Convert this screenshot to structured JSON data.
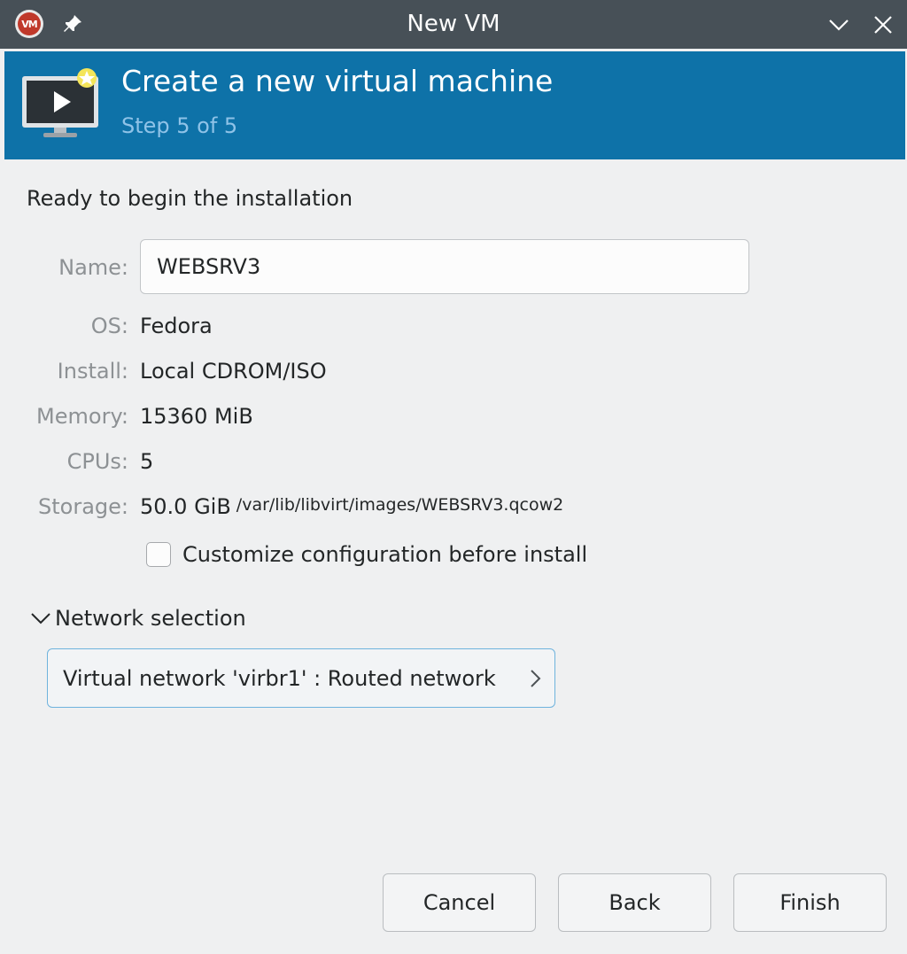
{
  "window": {
    "title": "New VM",
    "app_icon": "virt-manager-icon",
    "app_icon_text": "VM"
  },
  "header": {
    "title": "Create a new virtual machine",
    "step": "Step 5 of 5",
    "background": "#0e72a8",
    "icon": "monitor-play-icon"
  },
  "summary": {
    "heading": "Ready to begin the installation",
    "name_label": "Name:",
    "name_value": "WEBSRV3",
    "os_label": "OS:",
    "os_value": "Fedora",
    "install_label": "Install:",
    "install_value": "Local CDROM/ISO",
    "memory_label": "Memory:",
    "memory_value": "15360 MiB",
    "cpus_label": "CPUs:",
    "cpus_value": "5",
    "storage_label": "Storage:",
    "storage_size": "50.0 GiB",
    "storage_path": "/var/lib/libvirt/images/WEBSRV3.qcow2"
  },
  "customize": {
    "label": "Customize configuration before install",
    "checked": false
  },
  "network": {
    "section_label": "Network selection",
    "expanded": true,
    "selected": "Virtual network 'virbr1' : Routed network"
  },
  "buttons": {
    "cancel": "Cancel",
    "back": "Back",
    "finish": "Finish"
  }
}
